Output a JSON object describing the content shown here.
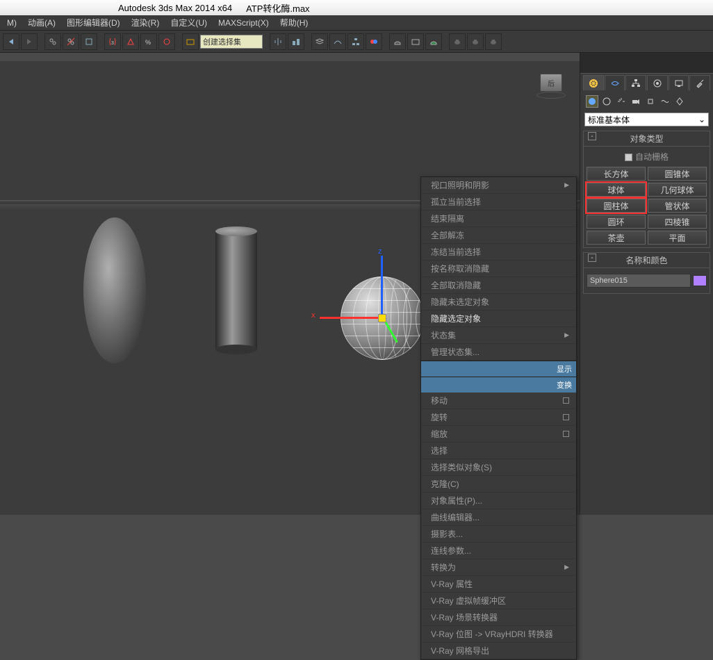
{
  "title": {
    "app": "Autodesk 3ds Max  2014 x64",
    "file": "ATP转化酶.max"
  },
  "menu": [
    "M)",
    "动画(A)",
    "图形编辑器(D)",
    "渲染(R)",
    "自定义(U)",
    "MAXScript(X)",
    "帮助(H)"
  ],
  "toolbar": {
    "selection_set": "创建选择集"
  },
  "viewcube": {
    "face": "后"
  },
  "context_menu": {
    "section1": [
      {
        "label": "视口照明和阴影",
        "sub": true,
        "bright": false
      },
      {
        "label": "孤立当前选择",
        "bright": false
      },
      {
        "label": "结束隔离",
        "bright": false
      },
      {
        "label": "全部解冻",
        "bright": false
      },
      {
        "label": "冻结当前选择",
        "bright": false
      },
      {
        "label": "按名称取消隐藏",
        "bright": false
      },
      {
        "label": "全部取消隐藏",
        "bright": false
      },
      {
        "label": "隐藏未选定对象",
        "bright": false
      },
      {
        "label": "隐藏选定对象",
        "bright": true
      },
      {
        "label": "状态集",
        "sub": true,
        "bright": false
      },
      {
        "label": "管理状态集...",
        "bright": false
      }
    ],
    "header1": "显示",
    "header2": "变换",
    "section2": [
      {
        "label": "移动",
        "box": true
      },
      {
        "label": "旋转",
        "box": true
      },
      {
        "label": "缩放",
        "box": true
      },
      {
        "label": "选择"
      },
      {
        "label": "选择类似对象(S)"
      },
      {
        "label": "克隆(C)"
      },
      {
        "label": "对象属性(P)..."
      },
      {
        "label": "曲线编辑器..."
      },
      {
        "label": "摄影表..."
      },
      {
        "label": "连线参数..."
      },
      {
        "label": "转换为",
        "sub": true
      },
      {
        "label": "V-Ray 属性"
      },
      {
        "label": "V-Ray 虚拟帧缓冲区"
      },
      {
        "label": "V-Ray 场景转换器"
      },
      {
        "label": "V-Ray 位图 -> VRayHDRI 转换器"
      },
      {
        "label": "V-Ray 网格导出"
      }
    ]
  },
  "panel": {
    "dropdown": "标准基本体",
    "rollout1_title": "对象类型",
    "autogrid": "自动栅格",
    "primitives": [
      [
        "长方体",
        "圆锥体"
      ],
      [
        "球体",
        "几何球体"
      ],
      [
        "圆柱体",
        "管状体"
      ],
      [
        "圆环",
        "四棱锥"
      ],
      [
        "茶壶",
        "平面"
      ]
    ],
    "highlighted": [
      "球体",
      "圆柱体"
    ],
    "rollout2_title": "名称和颜色",
    "object_name": "Sphere015"
  },
  "gizmo": {
    "x": "x",
    "z": "z"
  }
}
